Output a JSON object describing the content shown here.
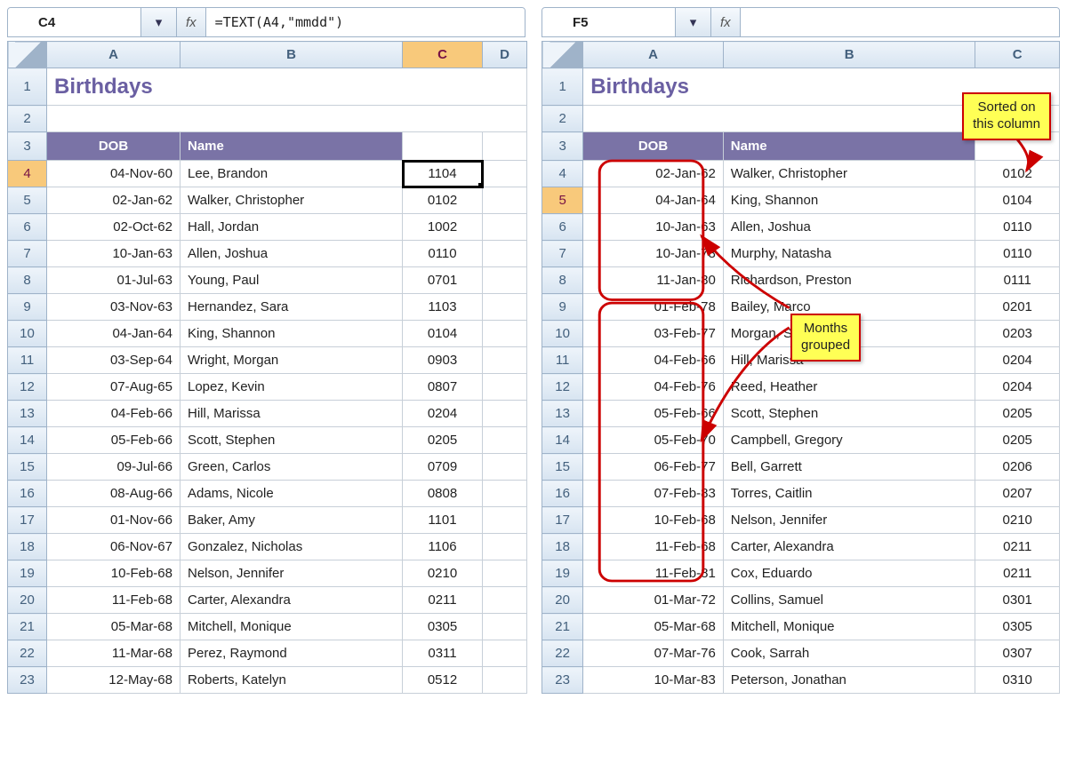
{
  "left": {
    "namebox": "C4",
    "formula": "=TEXT(A4,\"mmdd\")",
    "columns": [
      "A",
      "B",
      "C",
      "D"
    ],
    "selected_col": "C",
    "selected_row": 4,
    "selected_cell_value": "1104",
    "title": "Birthdays",
    "headers": {
      "dob": "DOB",
      "name": "Name"
    },
    "rows": [
      {
        "n": 4,
        "dob": "04-Nov-60",
        "name": "Lee, Brandon",
        "mmdd": "1104"
      },
      {
        "n": 5,
        "dob": "02-Jan-62",
        "name": "Walker, Christopher",
        "mmdd": "0102"
      },
      {
        "n": 6,
        "dob": "02-Oct-62",
        "name": "Hall, Jordan",
        "mmdd": "1002"
      },
      {
        "n": 7,
        "dob": "10-Jan-63",
        "name": "Allen, Joshua",
        "mmdd": "0110"
      },
      {
        "n": 8,
        "dob": "01-Jul-63",
        "name": "Young, Paul",
        "mmdd": "0701"
      },
      {
        "n": 9,
        "dob": "03-Nov-63",
        "name": "Hernandez, Sara",
        "mmdd": "1103"
      },
      {
        "n": 10,
        "dob": "04-Jan-64",
        "name": "King, Shannon",
        "mmdd": "0104"
      },
      {
        "n": 11,
        "dob": "03-Sep-64",
        "name": "Wright, Morgan",
        "mmdd": "0903"
      },
      {
        "n": 12,
        "dob": "07-Aug-65",
        "name": "Lopez, Kevin",
        "mmdd": "0807"
      },
      {
        "n": 13,
        "dob": "04-Feb-66",
        "name": "Hill, Marissa",
        "mmdd": "0204"
      },
      {
        "n": 14,
        "dob": "05-Feb-66",
        "name": "Scott, Stephen",
        "mmdd": "0205"
      },
      {
        "n": 15,
        "dob": "09-Jul-66",
        "name": "Green, Carlos",
        "mmdd": "0709"
      },
      {
        "n": 16,
        "dob": "08-Aug-66",
        "name": "Adams, Nicole",
        "mmdd": "0808"
      },
      {
        "n": 17,
        "dob": "01-Nov-66",
        "name": "Baker, Amy",
        "mmdd": "1101"
      },
      {
        "n": 18,
        "dob": "06-Nov-67",
        "name": "Gonzalez, Nicholas",
        "mmdd": "1106"
      },
      {
        "n": 19,
        "dob": "10-Feb-68",
        "name": "Nelson, Jennifer",
        "mmdd": "0210"
      },
      {
        "n": 20,
        "dob": "11-Feb-68",
        "name": "Carter, Alexandra",
        "mmdd": "0211"
      },
      {
        "n": 21,
        "dob": "05-Mar-68",
        "name": "Mitchell, Monique",
        "mmdd": "0305"
      },
      {
        "n": 22,
        "dob": "11-Mar-68",
        "name": "Perez, Raymond",
        "mmdd": "0311"
      },
      {
        "n": 23,
        "dob": "12-May-68",
        "name": "Roberts, Katelyn",
        "mmdd": "0512"
      }
    ]
  },
  "right": {
    "namebox": "F5",
    "formula": "",
    "columns": [
      "A",
      "B",
      "C"
    ],
    "selected_row": 5,
    "title": "Birthdays",
    "headers": {
      "dob": "DOB",
      "name": "Name"
    },
    "callout_sorted": "Sorted on\nthis column",
    "callout_grouped": "Months\ngrouped",
    "rows": [
      {
        "n": 4,
        "dob": "02-Jan-62",
        "name": "Walker, Christopher",
        "mmdd": "0102"
      },
      {
        "n": 5,
        "dob": "04-Jan-64",
        "name": "King, Shannon",
        "mmdd": "0104"
      },
      {
        "n": 6,
        "dob": "10-Jan-63",
        "name": "Allen, Joshua",
        "mmdd": "0110"
      },
      {
        "n": 7,
        "dob": "10-Jan-78",
        "name": "Murphy, Natasha",
        "mmdd": "0110"
      },
      {
        "n": 8,
        "dob": "11-Jan-80",
        "name": "Richardson, Preston",
        "mmdd": "0111"
      },
      {
        "n": 9,
        "dob": "01-Feb-78",
        "name": "Bailey, Marco",
        "mmdd": "0201"
      },
      {
        "n": 10,
        "dob": "03-Feb-77",
        "name": "Morgan, Steven",
        "mmdd": "0203"
      },
      {
        "n": 11,
        "dob": "04-Feb-66",
        "name": "Hill, Marissa",
        "mmdd": "0204"
      },
      {
        "n": 12,
        "dob": "04-Feb-76",
        "name": "Reed, Heather",
        "mmdd": "0204"
      },
      {
        "n": 13,
        "dob": "05-Feb-66",
        "name": "Scott, Stephen",
        "mmdd": "0205"
      },
      {
        "n": 14,
        "dob": "05-Feb-70",
        "name": "Campbell, Gregory",
        "mmdd": "0205"
      },
      {
        "n": 15,
        "dob": "06-Feb-77",
        "name": "Bell, Garrett",
        "mmdd": "0206"
      },
      {
        "n": 16,
        "dob": "07-Feb-83",
        "name": "Torres, Caitlin",
        "mmdd": "0207"
      },
      {
        "n": 17,
        "dob": "10-Feb-68",
        "name": "Nelson, Jennifer",
        "mmdd": "0210"
      },
      {
        "n": 18,
        "dob": "11-Feb-68",
        "name": "Carter, Alexandra",
        "mmdd": "0211"
      },
      {
        "n": 19,
        "dob": "11-Feb-81",
        "name": "Cox, Eduardo",
        "mmdd": "0211"
      },
      {
        "n": 20,
        "dob": "01-Mar-72",
        "name": "Collins, Samuel",
        "mmdd": "0301"
      },
      {
        "n": 21,
        "dob": "05-Mar-68",
        "name": "Mitchell, Monique",
        "mmdd": "0305"
      },
      {
        "n": 22,
        "dob": "07-Mar-76",
        "name": "Cook, Sarrah",
        "mmdd": "0307"
      },
      {
        "n": 23,
        "dob": "10-Mar-83",
        "name": "Peterson, Jonathan",
        "mmdd": "0310"
      }
    ]
  },
  "fx_label": "fx"
}
